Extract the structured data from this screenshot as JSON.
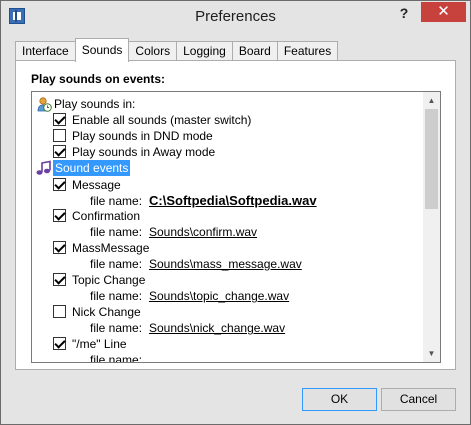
{
  "window": {
    "title": "Preferences",
    "help_label": "?",
    "close_label": "✕"
  },
  "tabs": [
    {
      "label": "Interface",
      "active": false
    },
    {
      "label": "Sounds",
      "active": true
    },
    {
      "label": "Colors",
      "active": false
    },
    {
      "label": "Logging",
      "active": false
    },
    {
      "label": "Board",
      "active": false
    },
    {
      "label": "Features",
      "active": false
    }
  ],
  "panel": {
    "group_label": "Play sounds on events:"
  },
  "tree": {
    "play_in": {
      "label": "Play sounds in:",
      "icon": "clock-person-icon",
      "options": [
        {
          "label": "Enable all sounds (master switch)",
          "checked": true
        },
        {
          "label": "Play sounds in DND mode",
          "checked": false
        },
        {
          "label": "Play sounds in Away mode",
          "checked": true
        }
      ]
    },
    "sound_events": {
      "label": "Sound events",
      "icon": "music-note-icon",
      "file_name_label": "file name:",
      "events": [
        {
          "label": "Message",
          "checked": true,
          "file": "C:\\Softpedia\\Softpedia.wav"
        },
        {
          "label": "Confirmation",
          "checked": true,
          "file": "Sounds\\confirm.wav"
        },
        {
          "label": "MassMessage",
          "checked": true,
          "file": "Sounds\\mass_message.wav"
        },
        {
          "label": "Topic Change",
          "checked": true,
          "file": "Sounds\\topic_change.wav"
        },
        {
          "label": "Nick Change",
          "checked": false,
          "file": "Sounds\\nick_change.wav"
        },
        {
          "label": "\"/me\" Line",
          "checked": true,
          "file": ""
        }
      ]
    }
  },
  "buttons": {
    "ok": "OK",
    "cancel": "Cancel"
  }
}
